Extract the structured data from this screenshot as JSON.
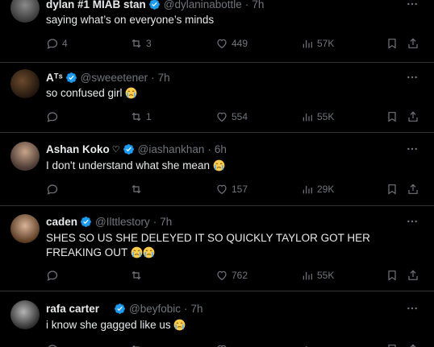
{
  "tweets": [
    {
      "name": "dylan #1 MIAB stan",
      "handle": "@dylaninabottle",
      "time": "7h",
      "text": "saying what’s on everyone’s minds",
      "replies": "4",
      "retweets": "3",
      "likes": "449",
      "views": "57K"
    },
    {
      "name": "Aᵀˢ",
      "handle": "@sweeetener",
      "time": "7h",
      "text": "so confused girl",
      "replies": "",
      "retweets": "1",
      "likes": "554",
      "views": "55K"
    },
    {
      "name": "Ashan Koko",
      "heart": "♡",
      "handle": "@iashankhan",
      "time": "6h",
      "text": "I don't understand what she mean",
      "replies": "",
      "retweets": "",
      "likes": "157",
      "views": "29K"
    },
    {
      "name": "caden",
      "handle": "@Ilttlestory",
      "time": "7h",
      "text": "SHES SO US SHE DELEYED IT SO QUICKLY TAYLOR GOT HER FREAKING OUT",
      "replies": "",
      "retweets": "",
      "likes": "762",
      "views": "55K"
    },
    {
      "name": "rafa carter",
      "handle": "@beyfobic",
      "time": "7h",
      "text": "i know she gagged like us",
      "replies": "",
      "retweets": "",
      "likes": "",
      "views": ""
    }
  ],
  "dot": "·",
  "colors": {
    "background": "#000000",
    "text": "#e7e9ea",
    "secondary": "#71767b",
    "verified": "#1d9bf0",
    "divider": "#2f3336"
  },
  "icons": [
    "reply-icon",
    "retweet-icon",
    "like-icon",
    "views-icon",
    "bookmark-icon",
    "share-icon",
    "more-icon",
    "verified-badge-icon",
    "crying-emoji-icon"
  ]
}
